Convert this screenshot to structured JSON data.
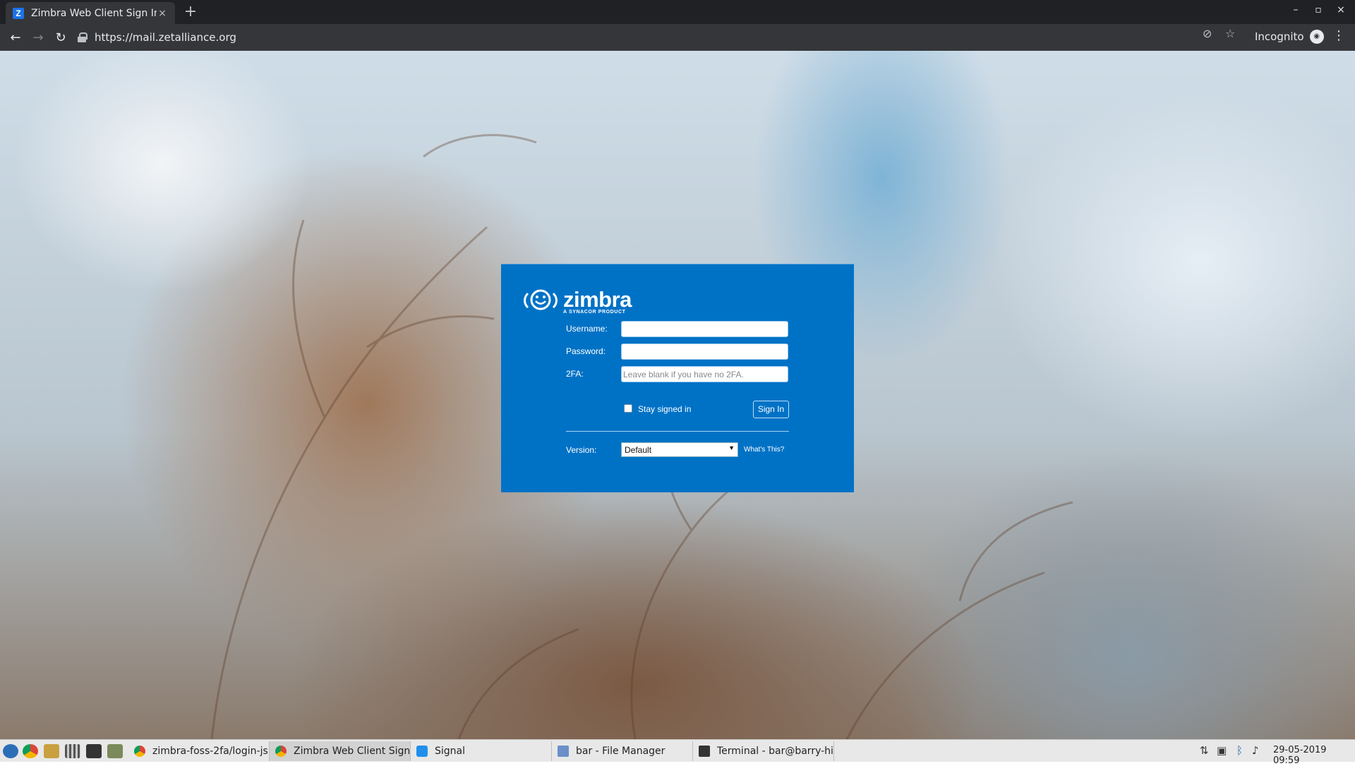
{
  "browser": {
    "tab_title": "Zimbra Web Client Sign In",
    "tab_favicon": "Z",
    "tab_close": "×",
    "new_tab": "+",
    "url": "https://mail.zetalliance.org",
    "incognito_label": "Incognito",
    "window_controls": [
      "–",
      "▫",
      "×"
    ]
  },
  "login": {
    "logo_text": "zimbra",
    "logo_subtext": "A SYNACOR PRODUCT",
    "username_label": "Username:",
    "username_value": "",
    "password_label": "Password:",
    "password_value": "",
    "twofa_label": "2FA:",
    "twofa_placeholder": "Leave blank if you have no 2FA.",
    "stay_signed_in_label": "Stay signed in",
    "stay_signed_in_checked": false,
    "signin_button": "Sign In",
    "version_label": "Version:",
    "version_selected": "Default",
    "whats_this": "What's This?"
  },
  "taskbar": {
    "tasks": [
      {
        "label": "zimbra-foss-2fa/login-js...",
        "icon": "chrome-icon",
        "active": false
      },
      {
        "label": "Zimbra Web Client Sign ...",
        "icon": "chrome-icon",
        "active": true
      },
      {
        "label": "Signal",
        "icon": "signal-icon",
        "active": false
      },
      {
        "label": "bar - File Manager",
        "icon": "folder-icon",
        "active": false
      },
      {
        "label": "Terminal - bar@barry-hi...",
        "icon": "terminal-icon",
        "active": false
      }
    ],
    "clock": "29-05-2019 09:59"
  },
  "colors": {
    "login_box": "#0072c6",
    "browser_dark": "#202124",
    "toolbar": "#35363a"
  }
}
